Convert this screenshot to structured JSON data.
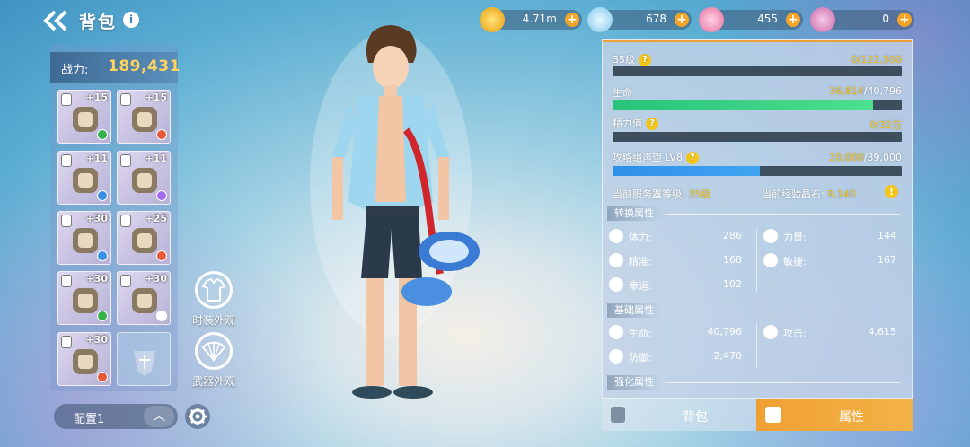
{
  "header": {
    "title": "背包",
    "info_icon": "i"
  },
  "currencies": [
    {
      "name": "gold-coin-icon",
      "value": "4.71m",
      "color": "#f6b80f"
    },
    {
      "name": "water-drop-icon",
      "value": "678",
      "color": "#9fd8f0"
    },
    {
      "name": "crystal-icon",
      "value": "455",
      "color": "#f07aa8"
    },
    {
      "name": "orb-icon",
      "value": "0",
      "color": "#e67fb7"
    }
  ],
  "power": {
    "label": "战力:",
    "value": "189,431"
  },
  "equipment": [
    {
      "name": "helmet",
      "level": "+15",
      "gem": "#36b04a"
    },
    {
      "name": "belt",
      "level": "+15",
      "gem": "#e85a3a"
    },
    {
      "name": "armor",
      "level": "+11",
      "gem": "#3a8fe8"
    },
    {
      "name": "gauntlet",
      "level": "+11",
      "gem": "#a46cf0"
    },
    {
      "name": "pants",
      "level": "+30",
      "gem": "#3a8fe8"
    },
    {
      "name": "ring",
      "level": "+25",
      "gem": "#e85a3a"
    },
    {
      "name": "boots",
      "level": "+30",
      "gem": "#36b04a"
    },
    {
      "name": "necklace",
      "level": "+30",
      "gem": "#ffffff"
    },
    {
      "name": "weapon",
      "level": "+30",
      "gem": "#e85a3a"
    }
  ],
  "appearance": {
    "costume": "时装外观",
    "weapon": "武器外观"
  },
  "config": {
    "label": "配置1",
    "up": "︿"
  },
  "stats": {
    "level": {
      "label": "35级",
      "value": "0/122,500",
      "fill": 0
    },
    "hp": {
      "label": "生命",
      "value_a": "36,814",
      "value_b": "/40,796",
      "fill": 0.9
    },
    "energy": {
      "label": "精力值",
      "value": "0/32万",
      "fill": 0
    },
    "prestige": {
      "label": "攻略组声望 LV8",
      "value_a": "20,000",
      "value_b": "/39,000",
      "fill": 0.51
    },
    "server_level": {
      "label": "当前服务器等级:",
      "value": "35级"
    },
    "exp_crystal": {
      "label": "当前经验晶石:",
      "value": "9,140"
    }
  },
  "sections": {
    "convert": "转换属性",
    "base": "基础属性",
    "enhance": "强化属性"
  },
  "convert_stats": [
    {
      "name": "体力:",
      "value": "286",
      "icon": "heart-icon"
    },
    {
      "name": "精准:",
      "value": "168",
      "icon": "crosshair-icon"
    },
    {
      "name": "幸运:",
      "value": "102",
      "icon": "clover-icon"
    },
    {
      "name": "力量:",
      "value": "144",
      "icon": "fist-icon"
    },
    {
      "name": "敏捷:",
      "value": "167",
      "icon": "lightning-icon"
    }
  ],
  "base_stats": [
    {
      "name": "生命:",
      "value": "40,796",
      "icon": "drop-icon"
    },
    {
      "name": "防御:",
      "value": "2,470",
      "icon": "shield-icon"
    },
    {
      "name": "攻击:",
      "value": "4,615",
      "icon": "sword-icon"
    }
  ],
  "tabs": {
    "bag": "背包",
    "attr": "属性"
  }
}
